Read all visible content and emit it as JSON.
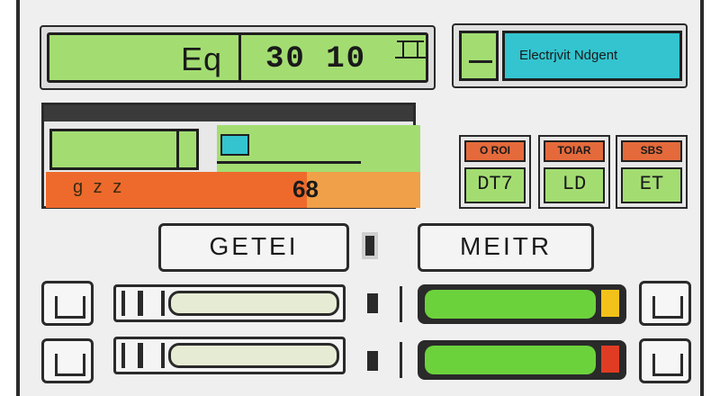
{
  "display": {
    "letter": "Eq",
    "reading": "30 10",
    "reading_display": "30 10"
  },
  "title_panel": {
    "text": "Electrjvit Ndgent"
  },
  "left_display": {
    "orange_text": "g z z",
    "value": "68"
  },
  "meters": [
    {
      "label": "O ROI",
      "value": "DT7"
    },
    {
      "label": "TOIAR",
      "value": "LD"
    },
    {
      "label": "SBS",
      "value": "ET"
    }
  ],
  "buttons": {
    "left": "GETEI",
    "right": "MEITR"
  },
  "sliders": {
    "row1": {
      "left_level": 0.95,
      "right_level": 0.9,
      "right_end_color": "#f2c21a"
    },
    "row2": {
      "left_level": 0.95,
      "right_level": 0.9,
      "right_end_color": "#e03c24"
    }
  },
  "colors": {
    "lcd_green": "#a3dd72",
    "cyan": "#33c4cf",
    "orange": "#ee6a2c",
    "bar_green": "#6cd23c"
  }
}
